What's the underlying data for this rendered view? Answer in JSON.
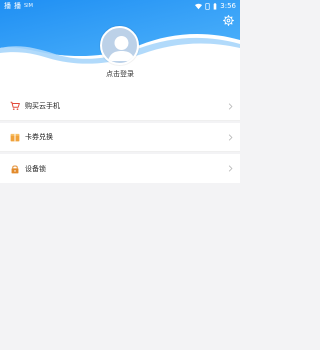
{
  "status_bar": {
    "left_texts": [
      "播",
      "播"
    ],
    "small_text": "SIM",
    "time": "3:56"
  },
  "colors": {
    "header_blue": "#2f9ef5",
    "header_light": "#7cc0f9",
    "avatar_bg": "#bcd1e8",
    "cart_icon": "#e34a3b",
    "card_icon": "#f0a23a",
    "lock_icon": "#e28a2b"
  },
  "header": {
    "settings_icon": "gear-icon",
    "avatar_icon": "user-avatar-icon",
    "login_label": "点击登录"
  },
  "menu": {
    "items": [
      {
        "label": "购买云手机",
        "icon": "cart-icon"
      },
      {
        "label": "卡券兑换",
        "icon": "gift-card-icon"
      },
      {
        "label": "设备锁",
        "icon": "lock-icon"
      }
    ]
  }
}
